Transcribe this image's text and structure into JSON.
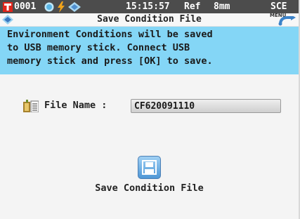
{
  "statusbar": {
    "channel": "0001",
    "time": "15:15:57",
    "ref_label": "Ref",
    "aperture": "8mm",
    "mode": "SCE"
  },
  "titlebar": {
    "title": "Save Condition File",
    "menu_label": "MENU"
  },
  "message": {
    "lines": [
      "Environment Conditions will be saved",
      "to USB memory stick. Connect USB",
      "memory stick and press [OK] to save."
    ]
  },
  "file_name": {
    "label": "File Name :",
    "value": "CF620091110"
  },
  "save_action": {
    "label": "Save Condition File"
  },
  "colors": {
    "status_bg": "#4c4c4c",
    "message_bg": "#84d6f6",
    "accent_red": "#e1251b",
    "save_icon_blue": "#4f97d6"
  }
}
